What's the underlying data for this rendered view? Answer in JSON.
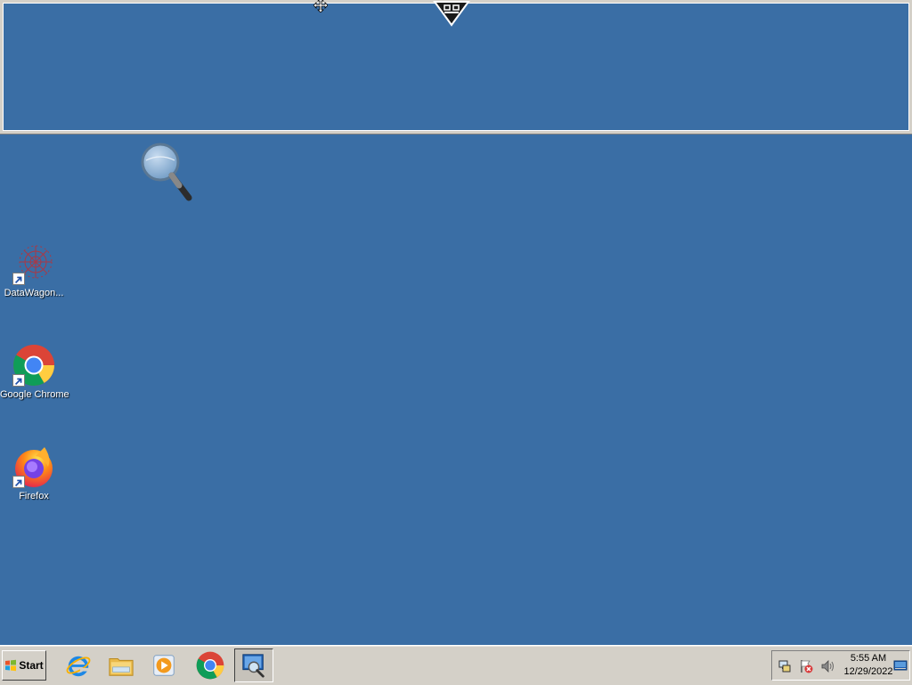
{
  "magnifier": {
    "pane_name": "Magnifier lens",
    "toolbar_handle": "magnifier-toolbar-handle",
    "cursor": "move-cursor"
  },
  "desktop": {
    "background_color": "#3a6ea5",
    "floating_icon": "magnifying-glass-icon",
    "icons": [
      {
        "label": "DataWagon...",
        "icon": "datawagon-icon"
      },
      {
        "label": "Google Chrome",
        "icon": "chrome-icon"
      },
      {
        "label": "Firefox",
        "icon": "firefox-icon"
      }
    ]
  },
  "taskbar": {
    "start_label": "Start",
    "pinned": [
      {
        "name": "internet-explorer-icon"
      },
      {
        "name": "file-explorer-icon"
      },
      {
        "name": "media-player-icon"
      },
      {
        "name": "chrome-icon"
      },
      {
        "name": "magnifier-app-icon",
        "active": true
      }
    ],
    "tray": {
      "icons": [
        "network-icon",
        "action-center-icon",
        "volume-icon"
      ],
      "time": "5:55 AM",
      "date": "12/29/2022"
    }
  }
}
